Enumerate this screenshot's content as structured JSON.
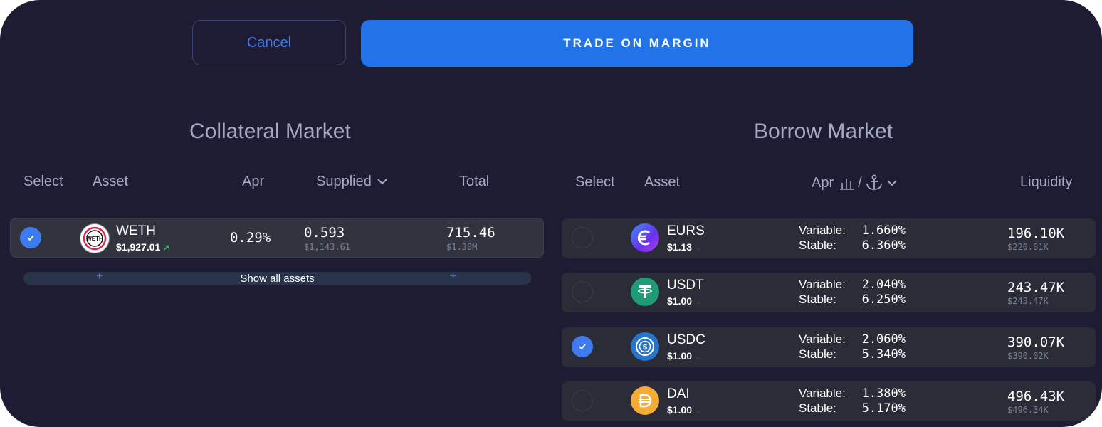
{
  "buttons": {
    "cancel": "Cancel",
    "trade": "TRADE ON MARGIN"
  },
  "collateral": {
    "title": "Collateral Market",
    "headers": {
      "select": "Select",
      "asset": "Asset",
      "apr": "Apr",
      "supplied": "Supplied",
      "total": "Total"
    },
    "rows": [
      {
        "symbol": "WETH",
        "price": "$1,927.01",
        "price_trend": "up",
        "apr": "0.29%",
        "supplied": "0.593",
        "supplied_usd": "$1,143.61",
        "total": "715.46",
        "total_usd": "$1.38M",
        "selected": true,
        "icon": "weth-icon"
      }
    ],
    "show_all": "Show all assets"
  },
  "borrow": {
    "title": "Borrow Market",
    "headers": {
      "select": "Select",
      "asset": "Asset",
      "apr": "Apr",
      "apr_separator": "/",
      "liquidity": "Liquidity"
    },
    "rows": [
      {
        "symbol": "EURS",
        "price": "$1.13",
        "variable_label": "Variable:",
        "variable": "1.660%",
        "stable_label": "Stable:",
        "stable": "6.360%",
        "liquidity": "196.10K",
        "liquidity_usd": "$220.81K",
        "selected": false,
        "icon": "eurs-icon",
        "color": "#5b3cf0"
      },
      {
        "symbol": "USDT",
        "price": "$1.00",
        "variable_label": "Variable:",
        "variable": "2.040%",
        "stable_label": "Stable:",
        "stable": "6.250%",
        "liquidity": "243.47K",
        "liquidity_usd": "$243.47K",
        "selected": false,
        "icon": "usdt-icon",
        "color": "#1e9c77"
      },
      {
        "symbol": "USDC",
        "price": "$1.00",
        "variable_label": "Variable:",
        "variable": "2.060%",
        "stable_label": "Stable:",
        "stable": "5.340%",
        "liquidity": "390.07K",
        "liquidity_usd": "$390.02K",
        "selected": true,
        "icon": "usdc-icon",
        "color": "#2775ca"
      },
      {
        "symbol": "DAI",
        "price": "$1.00",
        "variable_label": "Variable:",
        "variable": "1.380%",
        "stable_label": "Stable:",
        "stable": "5.170%",
        "liquidity": "496.43K",
        "liquidity_usd": "$496.34K",
        "selected": false,
        "icon": "dai-icon",
        "color": "#f5ac37"
      }
    ]
  },
  "colors": {
    "background": "#1e1c33",
    "accent": "#2272e8",
    "row": "#2a2d37",
    "positive": "#2fc36b"
  }
}
